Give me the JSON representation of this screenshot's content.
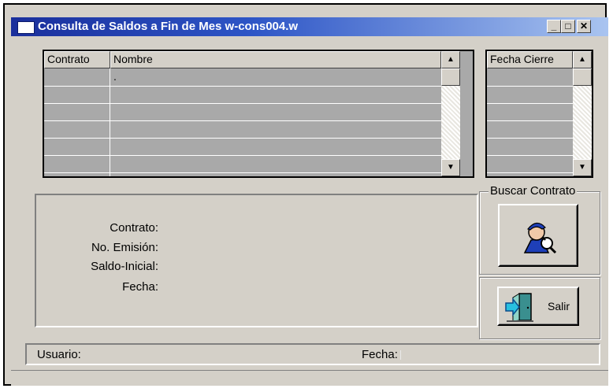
{
  "window": {
    "title": "Consulta de Saldos a Fin de Mes w-cons004.w",
    "controls": [
      "_",
      "□",
      "✕"
    ]
  },
  "grid_left": {
    "headers": [
      "Contrato",
      "Nombre"
    ],
    "rows": [
      [
        "",
        "."
      ],
      [
        "",
        ""
      ],
      [
        "",
        ""
      ],
      [
        "",
        ""
      ],
      [
        "",
        ""
      ],
      [
        "",
        ""
      ]
    ]
  },
  "grid_right": {
    "headers": [
      "Fecha Cierre"
    ]
  },
  "details": {
    "contrato_label": "Contrato:",
    "emision_label": "No. Emisión:",
    "saldo_label": "Saldo-Inicial:",
    "fecha_label": "Fecha:"
  },
  "buscar": {
    "group_label": "Buscar Contrato",
    "icon": "search-person-icon"
  },
  "salir": {
    "label": "Salir",
    "icon": "exit-door-icon"
  },
  "status": {
    "usuario_label": "Usuario:",
    "fecha_label": "Fecha:"
  },
  "colors": {
    "titlebar_start": "#1a2f9c",
    "titlebar_end": "#a9c4f0",
    "face": "#d4d0c8",
    "grid_bg": "#a9a9a9"
  }
}
